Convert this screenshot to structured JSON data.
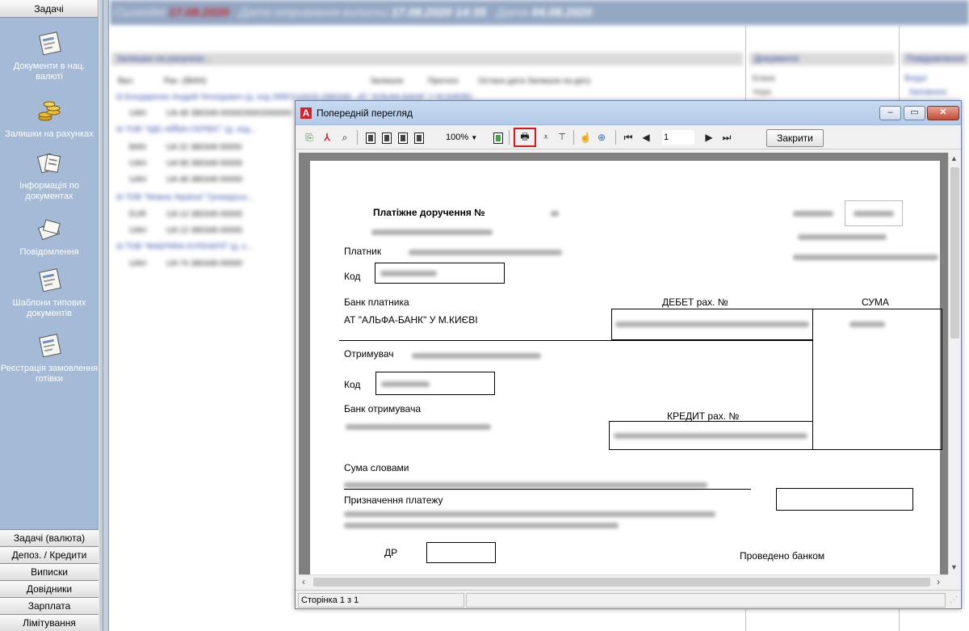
{
  "sidebar": {
    "top_tab": "Задачі",
    "items": [
      {
        "label": "Документи в нац. валюті",
        "icon": "document-form-icon"
      },
      {
        "label": "Залишки на рахунках",
        "icon": "coins-icon"
      },
      {
        "label": "Інформація по документах",
        "icon": "documents-info-icon"
      },
      {
        "label": "Повідомлення",
        "icon": "envelope-icon"
      },
      {
        "label": "Шаблони типових документів",
        "icon": "template-form-icon"
      },
      {
        "label": "Реєстрація замовлення готівки",
        "icon": "cash-order-form-icon"
      }
    ],
    "bottom_tabs": [
      "Задачі (валюта)",
      "Депоз. / Кредити",
      "Виписки",
      "Довідники",
      "Зарплата",
      "Лімітування"
    ]
  },
  "background": {
    "infobar_date_highlight": "17.08.2020",
    "infobar_time": "17.08.2020 14:35",
    "infobar_date2": "04.08.2020"
  },
  "preview": {
    "title": "Попередній перегляд",
    "zoom": "100%",
    "page_value": "1",
    "close_label": "Закрити",
    "status_page": "Сторінка 1 з 1",
    "toolbar_icons": [
      "export-icon",
      "pdf-icon",
      "find-icon",
      "single-page-icon",
      "two-page-icon",
      "four-page-icon",
      "multi-page-icon",
      "zoom-dropdown-icon",
      "page-setup-icon",
      "print-icon",
      "save-icon",
      "tree-icon",
      "hand-icon",
      "zoom-in-icon",
      "first-page-icon",
      "prev-page-icon",
      "next-page-icon",
      "last-page-icon"
    ]
  },
  "document": {
    "title": "Платіжне доручення №",
    "payer_label": "Платник",
    "code_label": "Код",
    "payer_bank_label": "Банк платника",
    "payer_bank_value": "АТ \"АЛЬФА-БАНК\" У М.КИЄВІ",
    "debit_label": "ДЕБЕТ рах. №",
    "sum_label": "СУМА",
    "recipient_label": "Отримувач",
    "recipient_code_label": "Код",
    "recipient_bank_label": "Банк отримувача",
    "credit_label": "КРЕДИТ рах. №",
    "sum_words_label": "Сума словами",
    "purpose_label": "Призначення платежу",
    "dr_label": "ДР",
    "processed_label": "Проведено банком"
  }
}
